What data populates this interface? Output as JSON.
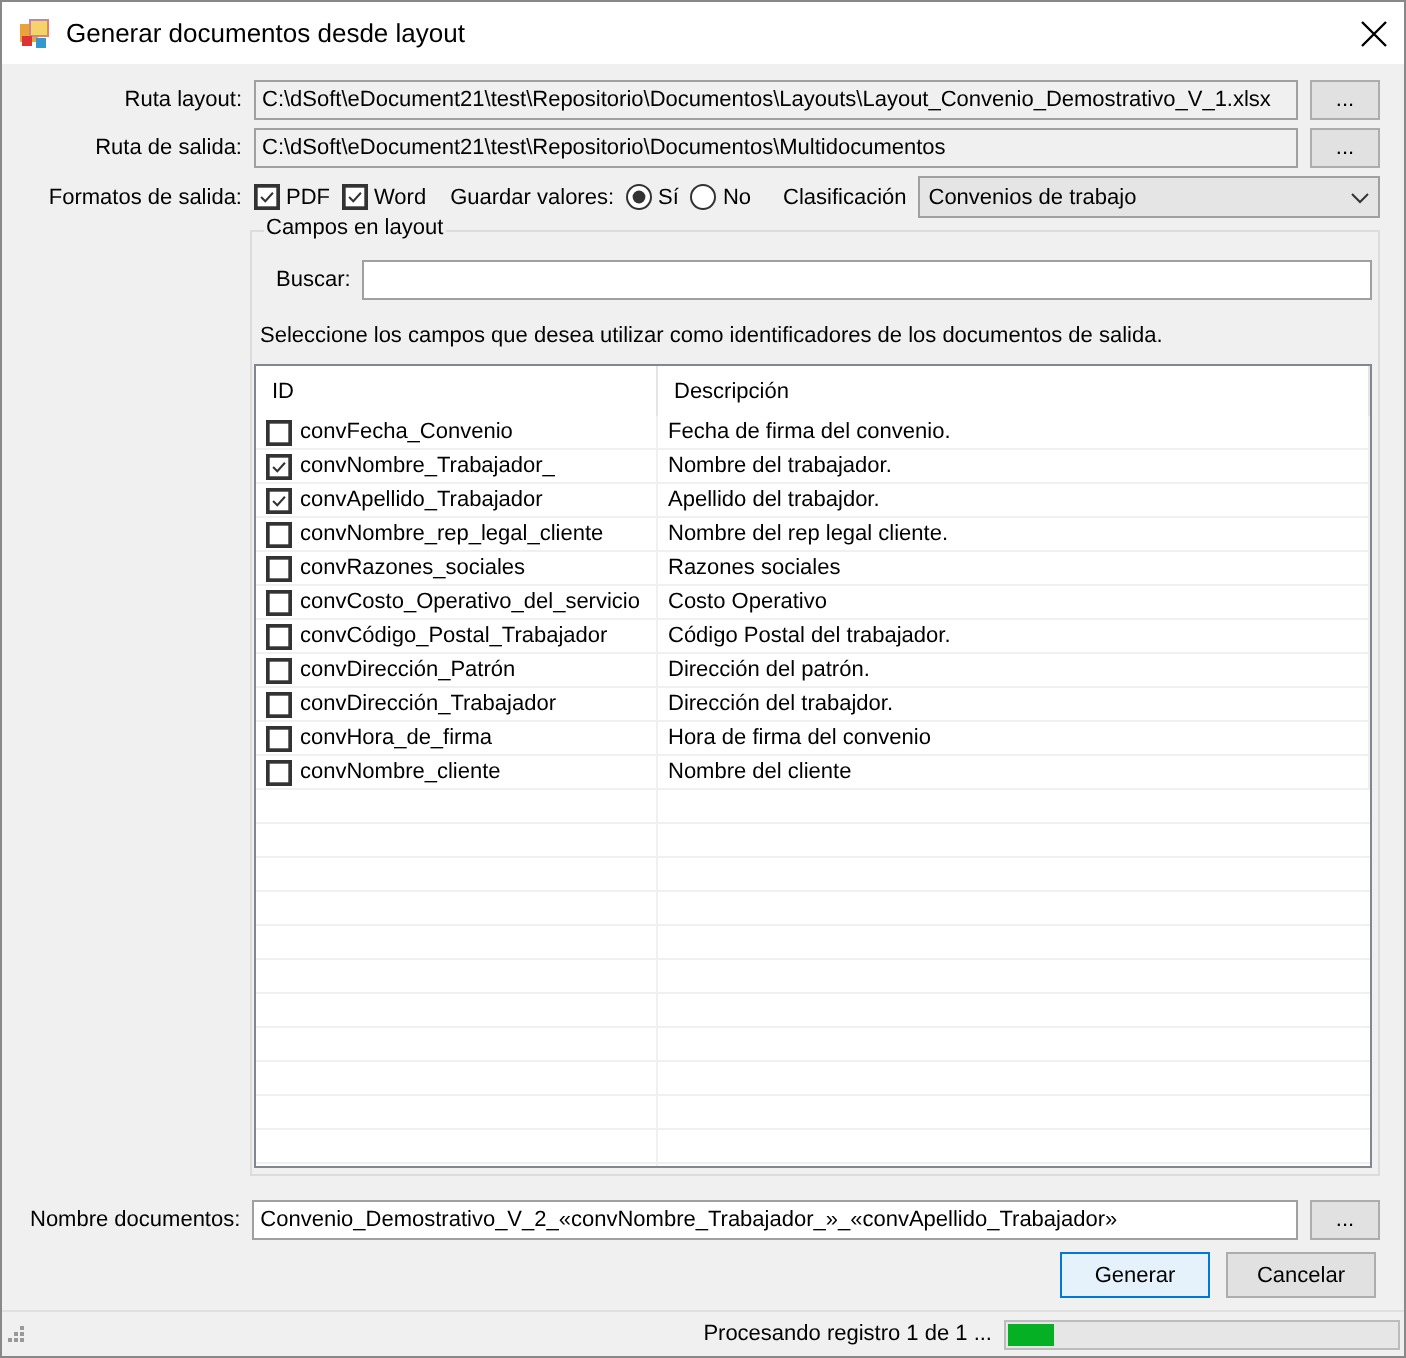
{
  "window": {
    "title": "Generar documentos desde layout"
  },
  "paths": [
    {
      "label": "Ruta layout:",
      "value": "C:\\dSoft\\eDocument21\\test\\Repositorio\\Documentos\\Layouts\\Layout_Convenio_Demostrativo_V_1.xlsx",
      "button": "..."
    },
    {
      "label": "Ruta de salida:",
      "value": "C:\\dSoft\\eDocument21\\test\\Repositorio\\Documentos\\Multidocumentos",
      "button": "..."
    }
  ],
  "formats": {
    "label": "Formatos de salida:",
    "options": [
      {
        "label": "PDF",
        "checked": true
      },
      {
        "label": "Word",
        "checked": true
      }
    ]
  },
  "save_values": {
    "label": "Guardar valores:",
    "options": [
      {
        "label": "Sí",
        "selected": true
      },
      {
        "label": "No",
        "selected": false
      }
    ]
  },
  "classification": {
    "label": "Clasificación",
    "value": "Convenios de trabajo"
  },
  "fields_group": {
    "title": "Campos en layout",
    "search_label": "Buscar:",
    "instruction": "Seleccione los campos que desea utilizar como identificadores de los documentos de salida.",
    "columns": [
      "ID",
      "Descripción"
    ],
    "rows": [
      {
        "id": "convFecha_Convenio",
        "description": "Fecha de firma del convenio.",
        "checked": false
      },
      {
        "id": "convNombre_Trabajador_",
        "description": "Nombre  del trabajador.",
        "checked": true
      },
      {
        "id": "convApellido_Trabajador",
        "description": "Apellido del trabajdor.",
        "checked": true
      },
      {
        "id": "convNombre_rep_legal_cliente",
        "description": "Nombre del rep legal cliente.",
        "checked": false
      },
      {
        "id": "convRazones_sociales",
        "description": "Razones sociales",
        "checked": false
      },
      {
        "id": "convCosto_Operativo_del_servicio",
        "description": "Costo Operativo",
        "checked": false
      },
      {
        "id": "convCódigo_Postal_Trabajador",
        "description": "Código Postal del trabajador.",
        "checked": false
      },
      {
        "id": "convDirección_Patrón",
        "description": "Dirección del patrón.",
        "checked": false
      },
      {
        "id": "convDirección_Trabajador",
        "description": "Dirección del trabajdor.",
        "checked": false
      },
      {
        "id": "convHora_de_firma",
        "description": "Hora de firma del convenio",
        "checked": false
      },
      {
        "id": "convNombre_cliente",
        "description": "Nombre del cliente",
        "checked": false
      }
    ]
  },
  "document_name": {
    "label": "Nombre documentos:",
    "value": "Convenio_Demostrativo_V_2_«convNombre_Trabajador_»_«convApellido_Trabajador»",
    "button": "..."
  },
  "buttons": [
    {
      "label": "Generar",
      "kind": "default"
    },
    {
      "label": "Cancelar",
      "kind": "normal"
    }
  ],
  "status_bar": {
    "text": "Procesando registro 1 de 1 ...",
    "level": 0.12
  }
}
